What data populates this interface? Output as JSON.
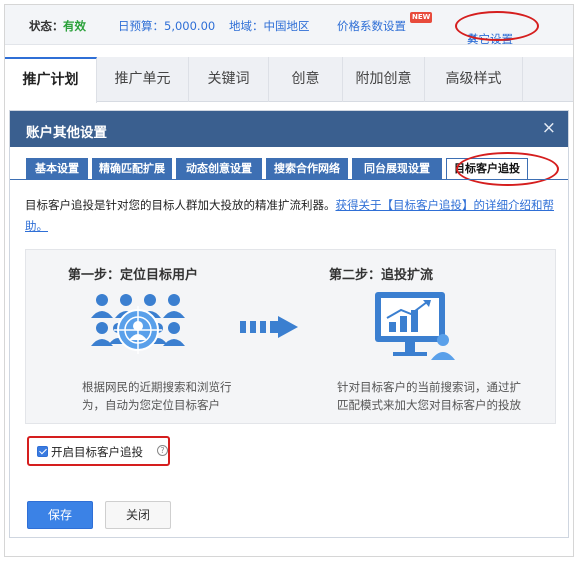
{
  "statusbar": {
    "status_label": "状态：",
    "status_value": "有效",
    "budget": "日预算：5,000.00",
    "region": "地域：中国地区",
    "price": "价格系数设置",
    "price_badge": "NEW",
    "other": "其它设置"
  },
  "main_tabs": [
    "推广计划",
    "推广单元",
    "关键词",
    "创意",
    "附加创意",
    "高级样式"
  ],
  "dialog": {
    "title": "账户其他设置",
    "close": "×",
    "subtabs": [
      "基本设置",
      "精确匹配扩展",
      "动态创意设置",
      "搜索合作网络",
      "同台展现设置",
      "目标客户追投"
    ],
    "description": "目标客户追投是针对您的目标人群加大投放的精准扩流利器。",
    "description_link": "获得关于【目标客户追投】的详细介绍和帮助。",
    "step1": {
      "title": "第一步：定位目标用户",
      "desc_line1": "根据网民的近期搜索和浏览行",
      "desc_line2": "为，自动为您定位目标客户"
    },
    "step2": {
      "title": "第二步：追投扩流",
      "desc_line1": "针对目标客户的当前搜索词，通过扩",
      "desc_line2": "匹配模式来加大您对目标客户的投放"
    },
    "checkbox_label": "开启目标客户追投",
    "checkbox_checked": true,
    "save": "保存",
    "close_button": "关闭"
  },
  "colors": {
    "header": "#3a5f8f",
    "subtab": "#3d6fb3",
    "accent_blue": "#2f6fd6",
    "highlight_red": "#d51e1e",
    "status_green": "#2aa13a"
  }
}
